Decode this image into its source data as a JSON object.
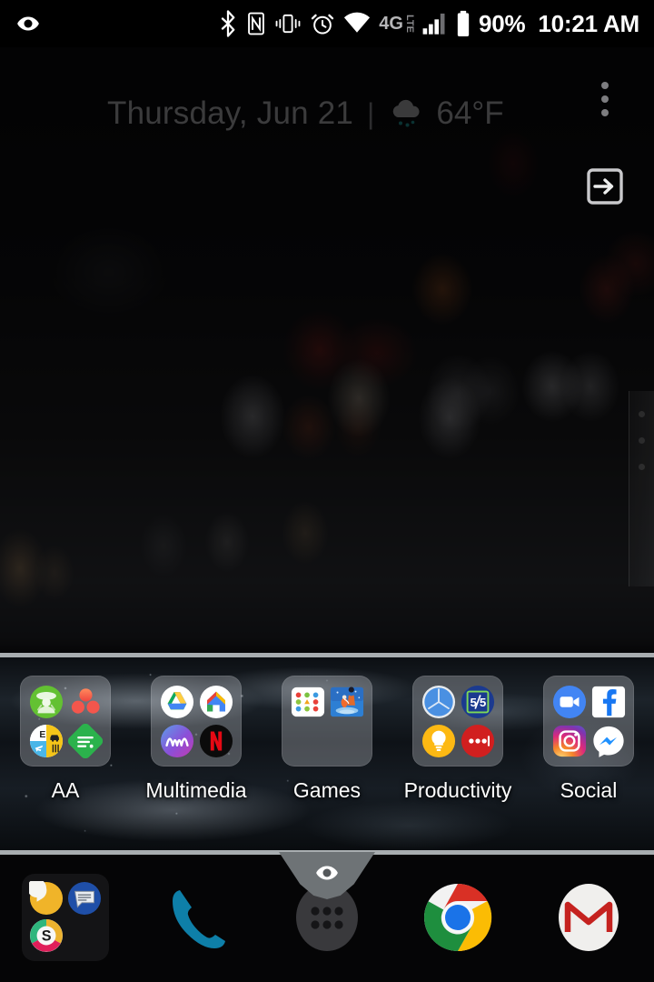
{
  "status_bar": {
    "left_icons": [
      {
        "name": "eye-filter-icon",
        "label": "Screen filter active"
      }
    ],
    "right_icons": [
      {
        "name": "bluetooth-icon",
        "label": "Bluetooth"
      },
      {
        "name": "nfc-icon",
        "label": "NFC"
      },
      {
        "name": "vibrate-icon",
        "label": "Vibrate mode"
      },
      {
        "name": "alarm-icon",
        "label": "Alarm set"
      },
      {
        "name": "wifi-icon",
        "label": "Wi-Fi"
      },
      {
        "name": "network-type-icon",
        "label": "4G LTE"
      },
      {
        "name": "signal-icon",
        "label": "Cellular signal"
      },
      {
        "name": "battery-icon",
        "label": "Battery"
      }
    ],
    "network_primary": "4G",
    "network_secondary": "LTE",
    "battery": "90%",
    "clock": "10:21 AM"
  },
  "widget": {
    "date": "Thursday, Jun 21",
    "separator": "|",
    "weather_icon": "rain-cloud-icon",
    "temperature": "64°F"
  },
  "top_controls": {
    "overflow_label": "More options",
    "exit_label": "Exit"
  },
  "page_indicator": {
    "pages": 3,
    "current": 1
  },
  "folders": [
    {
      "label": "AA",
      "apps": [
        {
          "name": "monopoly-icon",
          "label": "Monopoly"
        },
        {
          "name": "scan-dots-icon",
          "label": "Scan"
        },
        {
          "name": "travel-quadrant-icon",
          "label": "TripIt"
        },
        {
          "name": "feedly-icon",
          "label": "Feedly"
        }
      ]
    },
    {
      "label": "Multimedia",
      "apps": [
        {
          "name": "google-drive-icon",
          "label": "Drive"
        },
        {
          "name": "google-home-icon",
          "label": "Home"
        },
        {
          "name": "abc-icon",
          "label": "ABC"
        },
        {
          "name": "netflix-icon",
          "label": "Netflix"
        }
      ]
    },
    {
      "label": "Games",
      "apps": [
        {
          "name": "two-dots-icon",
          "label": "Two Dots"
        },
        {
          "name": "sky-game-icon",
          "label": "Sky"
        }
      ]
    },
    {
      "label": "Productivity",
      "apps": [
        {
          "name": "clock-icon",
          "label": "Clock"
        },
        {
          "name": "sheets-square-icon",
          "label": "Sheets"
        },
        {
          "name": "lightbulb-icon",
          "label": "Keep"
        },
        {
          "name": "todo-dots-icon",
          "label": "Tasks"
        }
      ]
    },
    {
      "label": "Social",
      "apps": [
        {
          "name": "google-duo-icon",
          "label": "Duo"
        },
        {
          "name": "facebook-icon",
          "label": "Facebook"
        },
        {
          "name": "instagram-icon",
          "label": "Instagram"
        },
        {
          "name": "messenger-icon",
          "label": "Messenger"
        }
      ]
    }
  ],
  "panel_handle": {
    "icon": "eye-filter-icon",
    "label": "Screen filter panel handle"
  },
  "dock": [
    {
      "name": "dock-folder-messaging",
      "type": "folder",
      "label": "Messaging",
      "apps": [
        {
          "name": "hangouts-icon",
          "label": "Hangouts"
        },
        {
          "name": "messages-icon",
          "label": "Messages"
        },
        {
          "name": "slack-icon",
          "label": "Slack"
        }
      ]
    },
    {
      "name": "dock-phone",
      "type": "app",
      "label": "Phone",
      "icon": "phone-icon"
    },
    {
      "name": "dock-app-drawer",
      "type": "app",
      "label": "All apps",
      "icon": "app-drawer-icon"
    },
    {
      "name": "dock-chrome",
      "type": "app",
      "label": "Chrome",
      "icon": "chrome-icon"
    },
    {
      "name": "dock-gmail",
      "type": "app",
      "label": "Gmail",
      "icon": "gmail-icon"
    }
  ],
  "colors": {
    "panel_border": "#a8adb0",
    "handle": "#6e7376",
    "status_bar_bg": "#000000",
    "label_text": "#ffffff",
    "widget_text": "#bebec0"
  }
}
